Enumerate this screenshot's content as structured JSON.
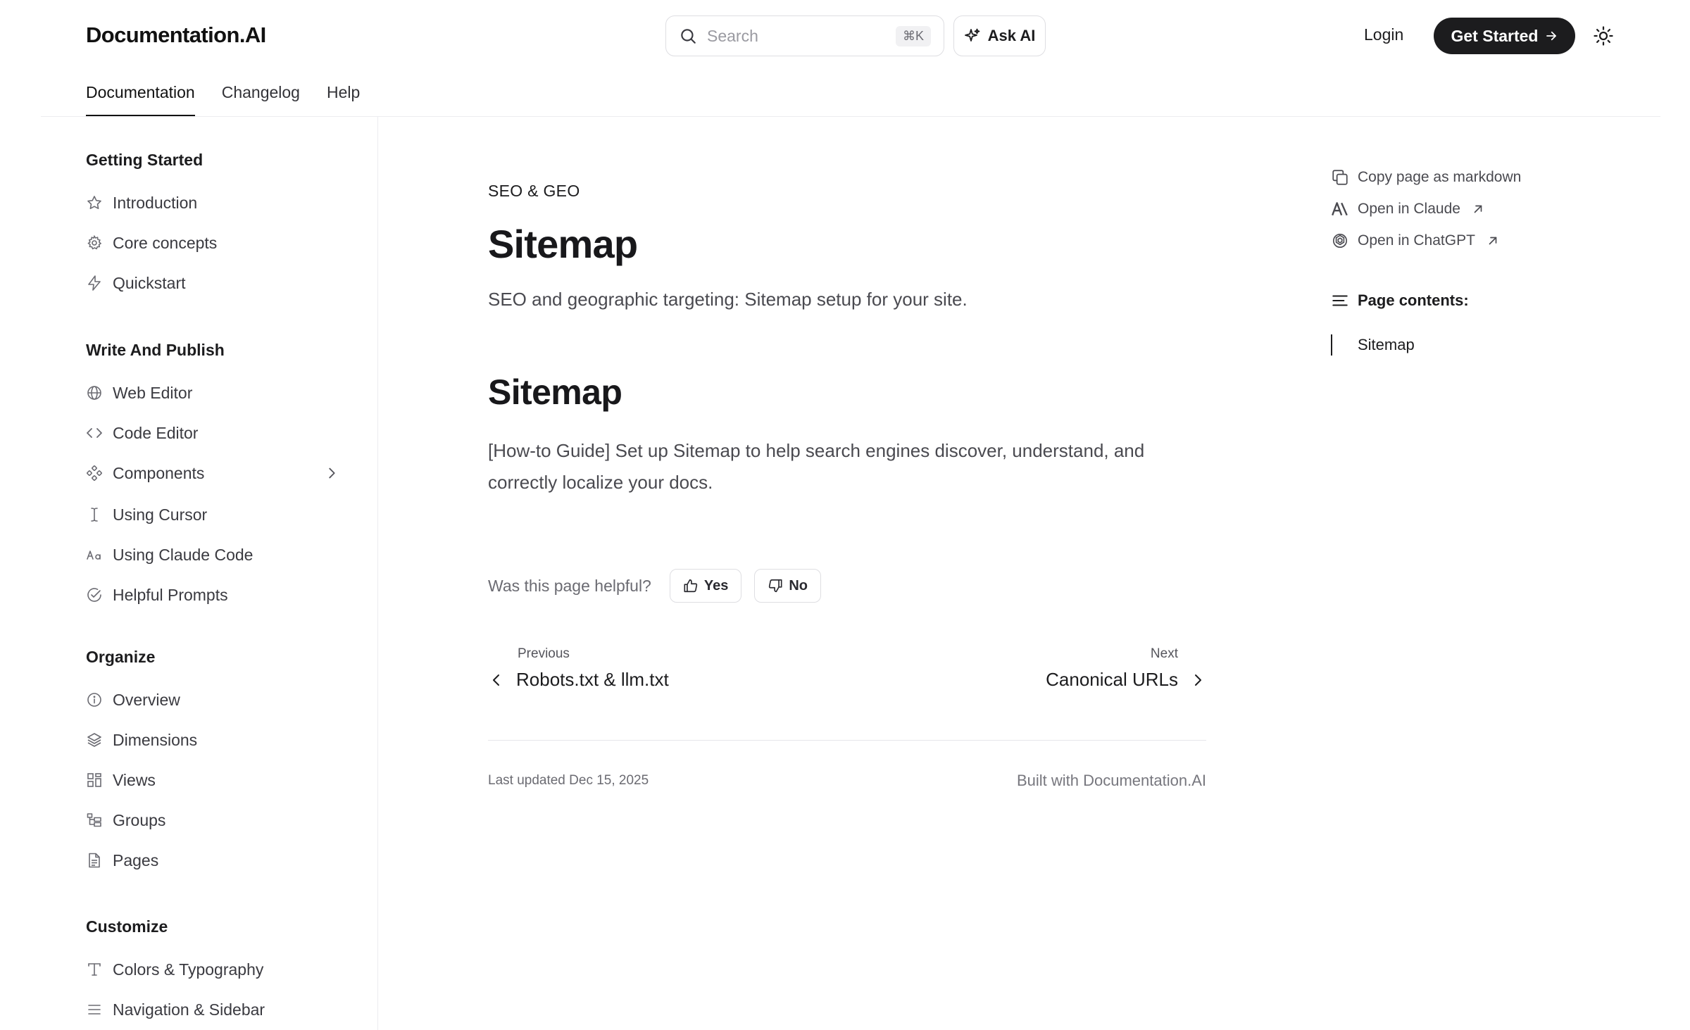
{
  "header": {
    "logo": "Documentation.AI",
    "search_placeholder": "Search",
    "search_shortcut": "⌘K",
    "ask_ai_label": "Ask AI",
    "login_label": "Login",
    "get_started_label": "Get Started"
  },
  "tabs": [
    {
      "label": "Documentation",
      "active": true
    },
    {
      "label": "Changelog",
      "active": false
    },
    {
      "label": "Help",
      "active": false
    }
  ],
  "sidebar": {
    "sections": [
      {
        "title": "Getting Started",
        "items": [
          {
            "label": "Introduction",
            "icon": "star-icon"
          },
          {
            "label": "Core concepts",
            "icon": "gear-icon"
          },
          {
            "label": "Quickstart",
            "icon": "lightning-icon"
          }
        ]
      },
      {
        "title": "Write And Publish",
        "items": [
          {
            "label": "Web Editor",
            "icon": "globe-icon"
          },
          {
            "label": "Code Editor",
            "icon": "code-icon"
          },
          {
            "label": "Components",
            "icon": "components-icon",
            "expandable": true
          },
          {
            "label": "Using Cursor",
            "icon": "text-cursor-icon"
          },
          {
            "label": "Using Claude Code",
            "icon": "font-size-icon"
          },
          {
            "label": "Helpful Prompts",
            "icon": "check-circle-icon"
          }
        ]
      },
      {
        "title": "Organize",
        "items": [
          {
            "label": "Overview",
            "icon": "info-icon"
          },
          {
            "label": "Dimensions",
            "icon": "layers-icon"
          },
          {
            "label": "Views",
            "icon": "grid-icon"
          },
          {
            "label": "Groups",
            "icon": "tree-icon"
          },
          {
            "label": "Pages",
            "icon": "file-icon"
          }
        ]
      },
      {
        "title": "Customize",
        "items": [
          {
            "label": "Colors & Typography",
            "icon": "type-icon"
          },
          {
            "label": "Navigation & Sidebar",
            "icon": "menu-icon"
          }
        ]
      }
    ]
  },
  "main": {
    "eyebrow": "SEO & GEO",
    "title": "Sitemap",
    "lead": "SEO and geographic targeting: Sitemap setup for your site.",
    "section_heading": "Sitemap",
    "paragraph": "[How-to Guide] Set up Sitemap to help search engines discover, understand, and correctly localize your docs.",
    "helpful_question": "Was this page helpful?",
    "yes_label": "Yes",
    "no_label": "No",
    "previous_label": "Previous",
    "previous_title": "Robots.txt & llm.txt",
    "next_label": "Next",
    "next_title": "Canonical URLs",
    "last_updated": "Last updated Dec 15, 2025",
    "built_with": "Built with Documentation.AI"
  },
  "rail": {
    "copy_markdown": "Copy page as markdown",
    "open_claude": "Open in Claude",
    "open_chatgpt": "Open in ChatGPT",
    "contents_title": "Page contents:",
    "toc": [
      "Sitemap"
    ]
  }
}
